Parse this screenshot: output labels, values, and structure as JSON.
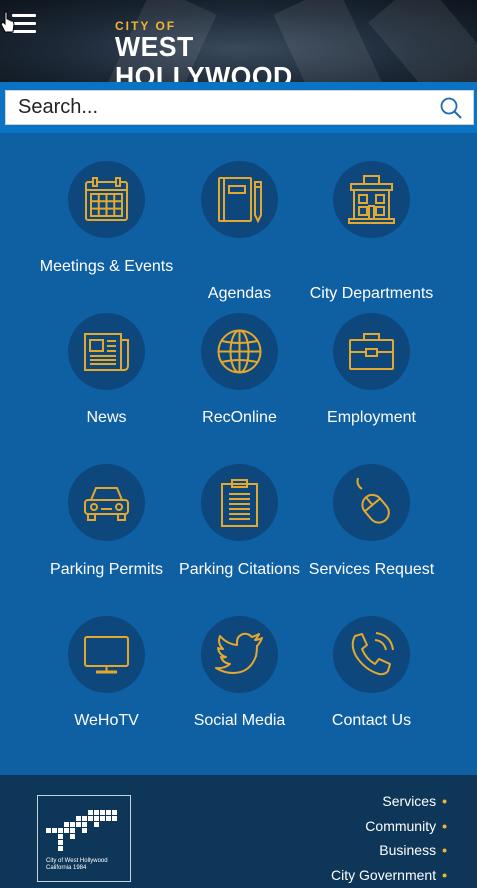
{
  "header": {
    "logo_small": "CITY OF",
    "logo_big": "WEST HOLLYWOOD",
    "menu_icon": "hamburger-menu-icon"
  },
  "search": {
    "placeholder": "Search...",
    "icon": "search-icon"
  },
  "tiles": [
    {
      "label": "Meetings & Events",
      "icon": "calendar-icon"
    },
    {
      "label": "Agendas",
      "icon": "notebook-pen-icon"
    },
    {
      "label": "City Departments",
      "icon": "building-icon"
    },
    {
      "label": "News",
      "icon": "newspaper-icon"
    },
    {
      "label": "RecOnline",
      "icon": "globe-icon"
    },
    {
      "label": "Employment",
      "icon": "briefcase-icon"
    },
    {
      "label": "Parking Permits",
      "icon": "car-icon"
    },
    {
      "label": "Parking Citations",
      "icon": "clipboard-icon"
    },
    {
      "label": "Services Request",
      "icon": "mouse-icon"
    },
    {
      "label": "WeHoTV",
      "icon": "tv-icon"
    },
    {
      "label": "Social Media",
      "icon": "twitter-bird-icon"
    },
    {
      "label": "Contact Us",
      "icon": "phone-icon"
    }
  ],
  "footer": {
    "seal_line1": "City of West Hollywood",
    "seal_line2": "California 1984",
    "links": [
      "Services",
      "Community",
      "Business",
      "City Government"
    ],
    "bullet": "•"
  },
  "colors": {
    "background": "#0f5fa3",
    "icon_circle": "#0d477c",
    "accent_gold": "#f2b632",
    "footer": "#0e3659",
    "search_strip": "#0a73c4"
  }
}
